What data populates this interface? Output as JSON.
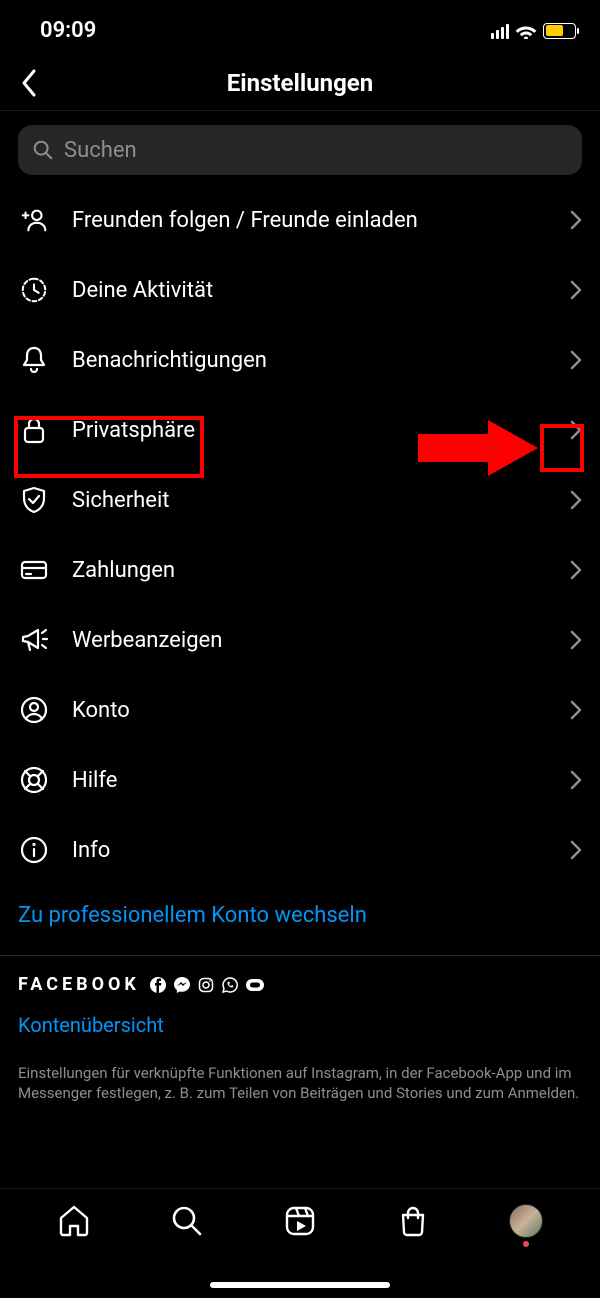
{
  "status": {
    "time": "09:09"
  },
  "header": {
    "title": "Einstellungen"
  },
  "search": {
    "placeholder": "Suchen"
  },
  "menu": [
    {
      "key": "follow-invite",
      "label": "Freunden folgen / Freunde einladen"
    },
    {
      "key": "activity",
      "label": "Deine Aktivität"
    },
    {
      "key": "notifications",
      "label": "Benachrichtigungen"
    },
    {
      "key": "privacy",
      "label": "Privatsphäre"
    },
    {
      "key": "security",
      "label": "Sicherheit"
    },
    {
      "key": "payments",
      "label": "Zahlungen"
    },
    {
      "key": "ads",
      "label": "Werbeanzeigen"
    },
    {
      "key": "account",
      "label": "Konto"
    },
    {
      "key": "help",
      "label": "Hilfe"
    },
    {
      "key": "about",
      "label": "Info"
    }
  ],
  "switch_link": "Zu professionellem Konto wechseln",
  "fb": {
    "brand": "FACEBOOK",
    "accounts_center": "Kontenübersicht",
    "description": "Einstellungen für verknüpfte Funktionen auf Instagram, in der Facebook-App und im Messenger festlegen, z. B. zum Teilen von Beiträgen und Stories und zum Anmelden."
  },
  "annotation": {
    "highlighted_item": "privacy"
  }
}
